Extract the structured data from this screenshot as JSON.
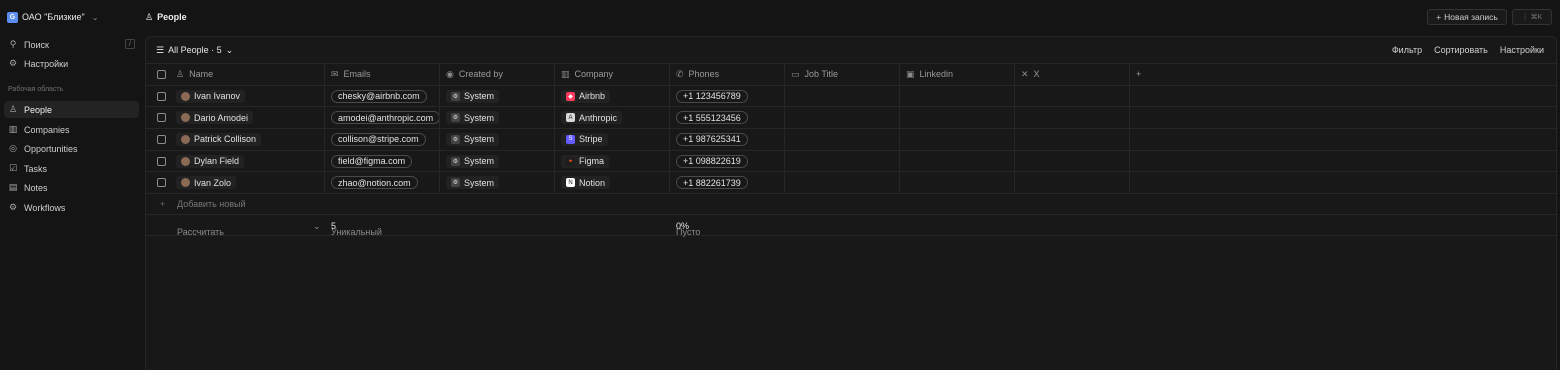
{
  "workspace": {
    "logo_letter": "G",
    "name": "ОАО \"Близкие\""
  },
  "sidebar": {
    "search_label": "Поиск",
    "search_shortcut": "/",
    "settings_label": "Настройки",
    "section_label": "Рабочая область",
    "items": [
      {
        "label": "People",
        "icon": "person-icon",
        "active": true
      },
      {
        "label": "Companies",
        "icon": "building-icon"
      },
      {
        "label": "Opportunities",
        "icon": "target-icon"
      },
      {
        "label": "Tasks",
        "icon": "checkbox-icon"
      },
      {
        "label": "Notes",
        "icon": "note-icon"
      },
      {
        "label": "Workflows",
        "icon": "workflow-icon"
      }
    ]
  },
  "header": {
    "page_title": "People",
    "new_record_label": "Новая запись",
    "command_shortcut": "⋮ ⌘K"
  },
  "view": {
    "name": "All People · 5",
    "actions": {
      "filter": "Фильтр",
      "sort": "Сортировать",
      "options": "Настройки"
    }
  },
  "table": {
    "columns": {
      "name": "Name",
      "emails": "Emails",
      "created_by": "Created by",
      "company": "Company",
      "phones": "Phones",
      "job_title": "Job Title",
      "linkedin": "Linkedin",
      "x": "X"
    },
    "rows": [
      {
        "name": "Ivan Ivanov",
        "email": "chesky@airbnb.com",
        "created_by": "System",
        "company": "Airbnb",
        "company_color": "#ff385c",
        "phone": "+1 123456789"
      },
      {
        "name": "Dario Amodei",
        "email": "amodei@anthropic.com",
        "created_by": "System",
        "company": "Anthropic",
        "company_color": "#d8d8d8",
        "phone": "+1 555123456"
      },
      {
        "name": "Patrick Collison",
        "email": "collison@stripe.com",
        "created_by": "System",
        "company": "Stripe",
        "company_color": "#635bff",
        "phone": "+1 987625341"
      },
      {
        "name": "Dylan Field",
        "email": "field@figma.com",
        "created_by": "System",
        "company": "Figma",
        "company_color": "#1e1e1e",
        "phone": "+1 098822619"
      },
      {
        "name": "Ivan Zolo",
        "email": "zhao@notion.com",
        "created_by": "System",
        "company": "Notion",
        "company_color": "#ffffff",
        "phone": "+1 882261739"
      }
    ],
    "add_new_label": "Добавить новый",
    "footer": {
      "calculate_label": "Рассчитать",
      "unique_label": "Уникальный",
      "unique_value": "5",
      "empty_label": "Пусто",
      "empty_value": "0%"
    }
  }
}
